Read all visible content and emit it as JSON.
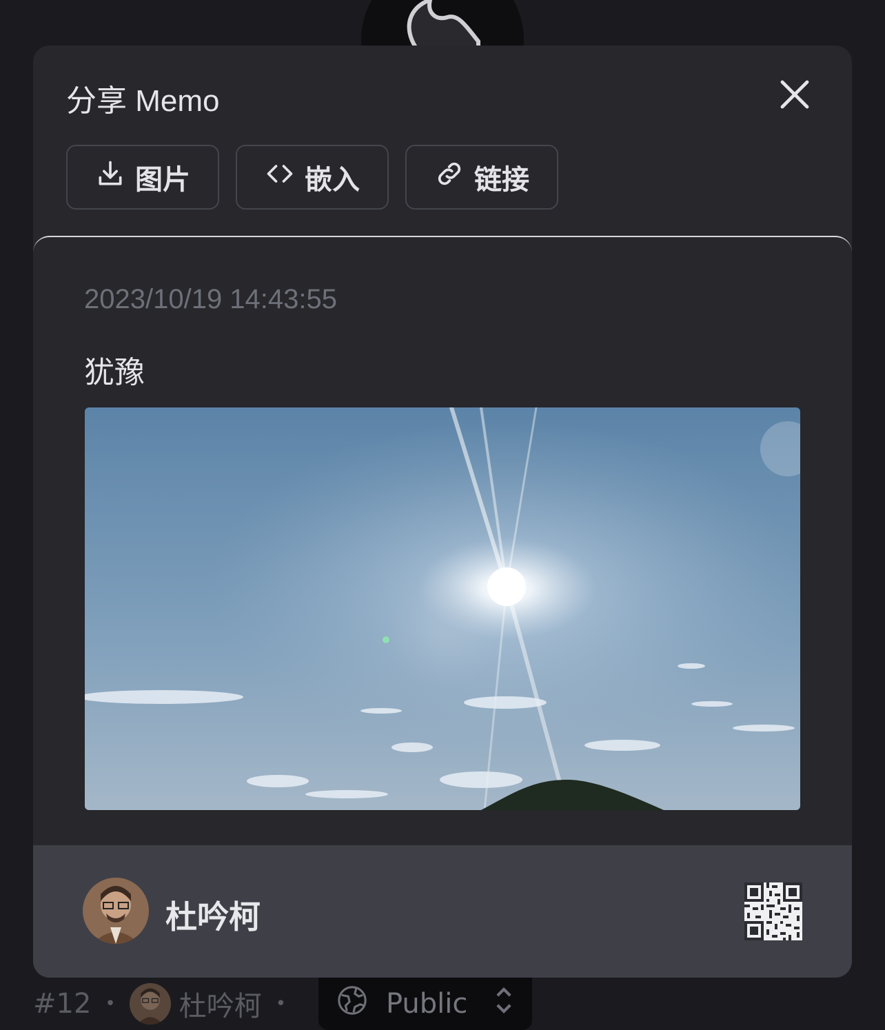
{
  "dialog": {
    "title": "分享 Memo",
    "close_icon": "close-icon",
    "actions": [
      {
        "label": "图片",
        "icon": "download-icon"
      },
      {
        "label": "嵌入",
        "icon": "code-icon"
      },
      {
        "label": "链接",
        "icon": "link-icon"
      }
    ]
  },
  "memo": {
    "timestamp": "2023/10/19 14:43:55",
    "content": "犹豫",
    "image_alt": "sky-with-sun-photo"
  },
  "footer": {
    "author_name": "杜吟柯",
    "qr_icon": "qr-code-icon"
  },
  "background": {
    "memo_id": "#12",
    "author_name": "杜吟柯",
    "visibility": "Public"
  },
  "colors": {
    "page_bg": "#1b1b1f",
    "dialog_bg": "#27272c",
    "footer_bg": "#3f3f48",
    "muted_text": "#6e7079",
    "text": "#e6e6ea"
  }
}
